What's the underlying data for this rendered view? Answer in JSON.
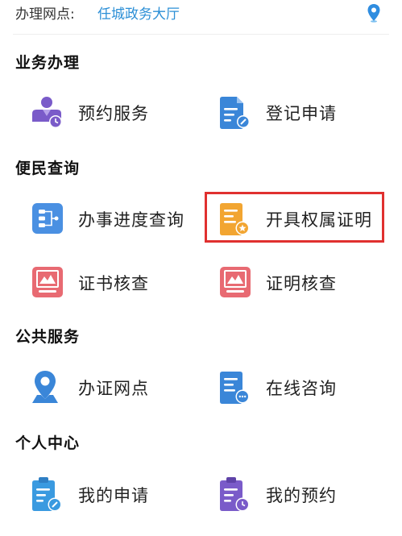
{
  "header": {
    "label": "办理网点:",
    "location": "任城政务大厅",
    "pin_icon": "location-pin-icon"
  },
  "colors": {
    "accent": "#2c8fd6",
    "purple": "#7a5bc9",
    "blue": "#3a86d8",
    "orange": "#f2a531",
    "red": "#e86a72",
    "highlight": "#e0302f"
  },
  "sections": [
    {
      "title": "业务办理",
      "items": [
        {
          "label": "预约服务",
          "icon": "appointment-icon"
        },
        {
          "label": "登记申请",
          "icon": "registration-form-icon"
        }
      ]
    },
    {
      "title": "便民查询",
      "items": [
        {
          "label": "办事进度查询",
          "icon": "progress-query-icon"
        },
        {
          "label": "开具权属证明",
          "icon": "ownership-certificate-icon"
        },
        {
          "label": "证书核查",
          "icon": "certificate-check-icon"
        },
        {
          "label": "证明核查",
          "icon": "proof-check-icon"
        }
      ]
    },
    {
      "title": "公共服务",
      "items": [
        {
          "label": "办证网点",
          "icon": "service-location-icon"
        },
        {
          "label": "在线咨询",
          "icon": "online-consult-icon"
        }
      ]
    },
    {
      "title": "个人中心",
      "items": [
        {
          "label": "我的申请",
          "icon": "my-application-icon"
        },
        {
          "label": "我的预约",
          "icon": "my-appointment-icon"
        }
      ]
    }
  ]
}
